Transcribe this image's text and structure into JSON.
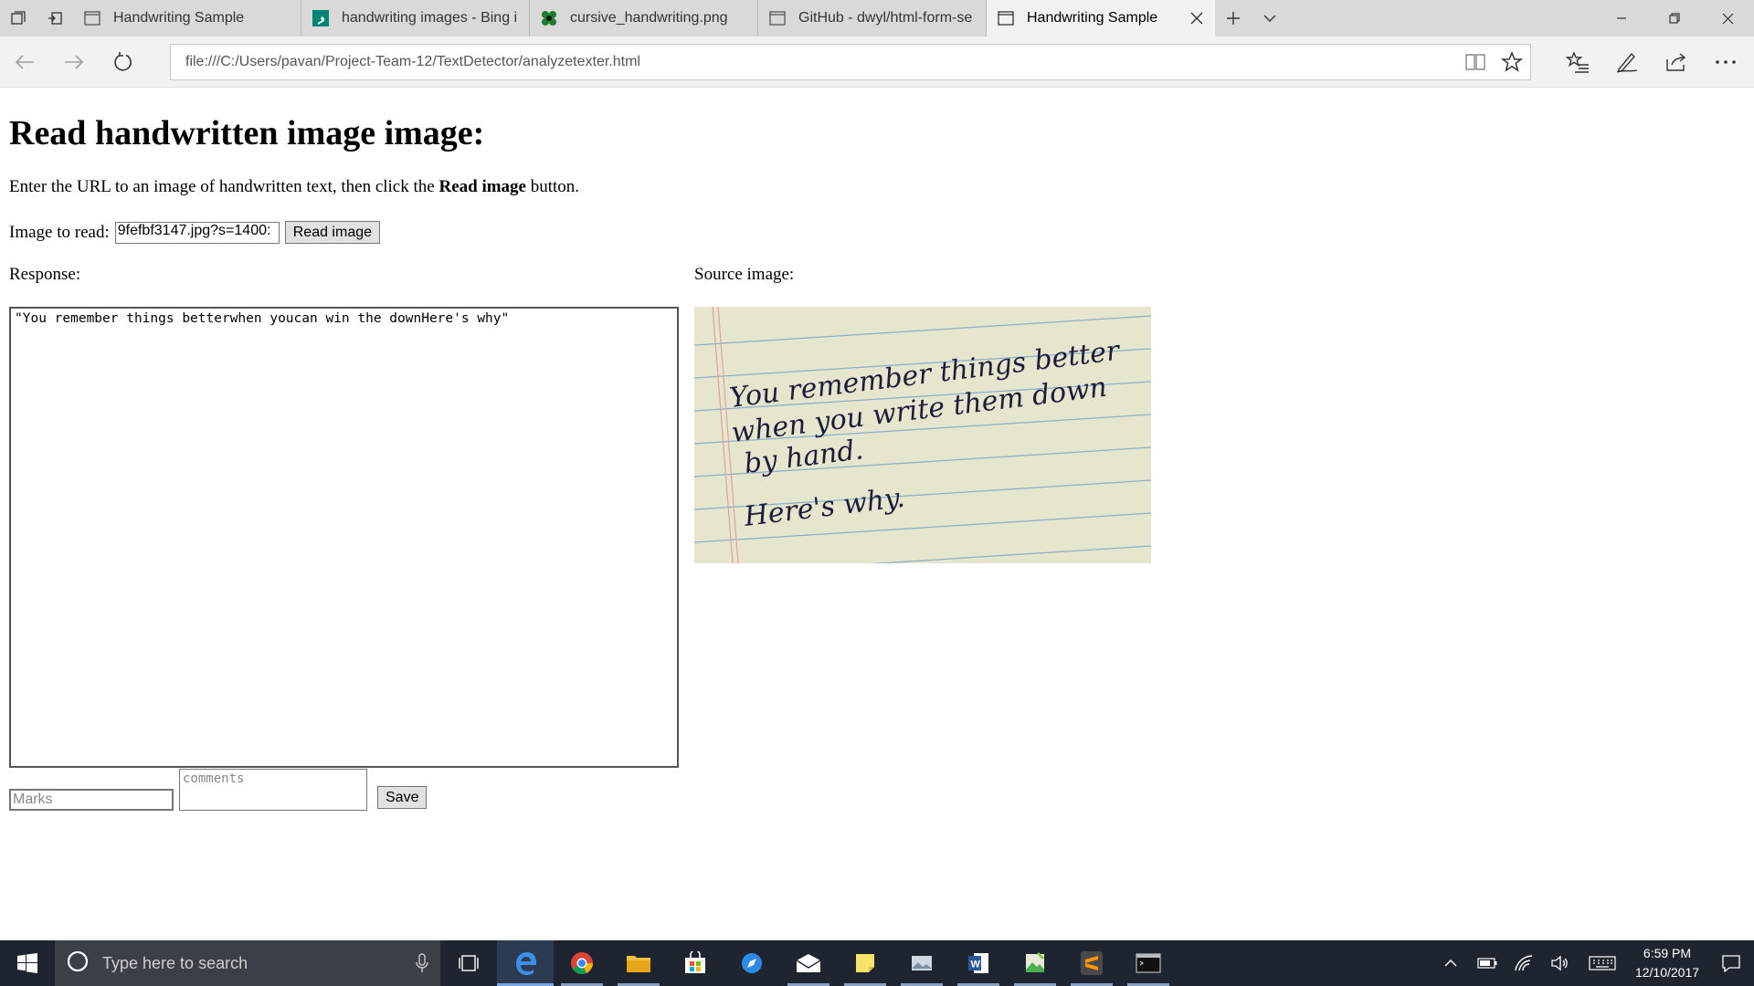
{
  "browser": {
    "tabs": [
      {
        "title": "Handwriting Sample",
        "icon": "page-icon",
        "active": false
      },
      {
        "title": "handwriting images - Bing i",
        "icon": "bing-icon",
        "active": false
      },
      {
        "title": "cursive_handwriting.png",
        "icon": "image-icon",
        "active": false
      },
      {
        "title": "GitHub - dwyl/html-form-se",
        "icon": "page-icon",
        "active": false
      },
      {
        "title": "Handwriting Sample",
        "icon": "page-icon",
        "active": true
      }
    ],
    "address_url": "file:///C:/Users/pavan/Project-Team-12/TextDetector/analyzetexter.html"
  },
  "page": {
    "heading": "Read handwritten image image:",
    "intro_before": "Enter the URL to an image of handwritten text, then click the ",
    "intro_bold": "Read image",
    "intro_after": " button.",
    "image_label": "Image to read:",
    "image_url_value": ":9fefbf3147.jpg?s=1400",
    "read_button": "Read image",
    "response_label": "Response:",
    "source_label": "Source image:",
    "response_text": "\"You remember things betterwhen youcan win the downHere's why\"",
    "source_image_text": [
      "You remember things better",
      "when you write them down",
      "by hand.",
      "Here's why."
    ],
    "marks_placeholder": "Marks",
    "comments_placeholder": "comments",
    "save_button": "Save"
  },
  "taskbar": {
    "search_placeholder": "Type here to search",
    "time": "6:59 PM",
    "date": "12/10/2017"
  },
  "colors": {
    "tabstrip": "#d9d9d9",
    "active_tab": "#f2f2f2",
    "taskbar": "#1e2430",
    "paper": "#e6e6cf",
    "ink": "#1c1c3a"
  }
}
